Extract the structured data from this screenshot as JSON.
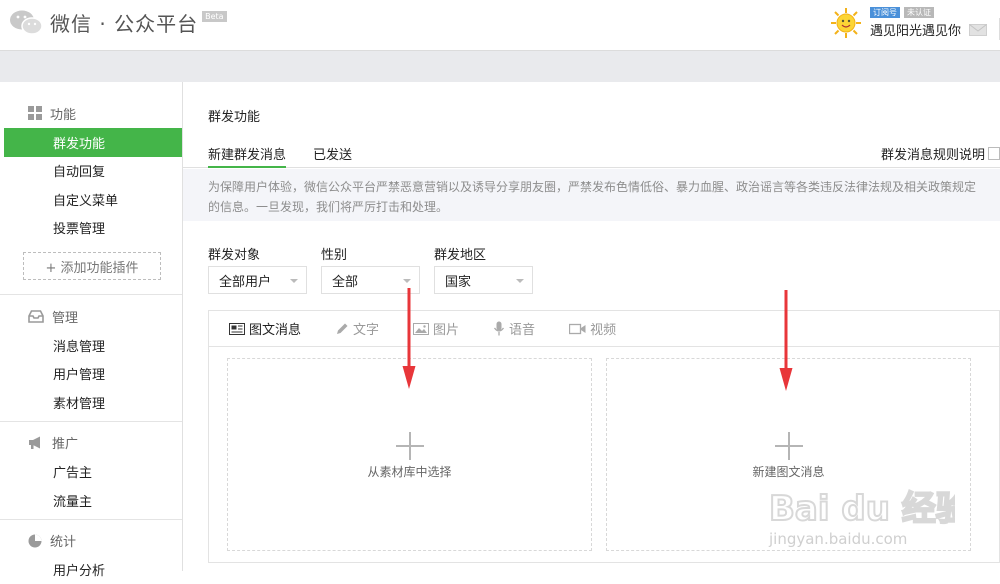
{
  "header": {
    "title": "微信 · 公众平台",
    "beta": "Beta",
    "tag_subscription": "订阅号",
    "tag_unverified": "未认证",
    "username": "遇见阳光遇见你"
  },
  "sidebar": {
    "groups": [
      {
        "title": "功能",
        "icon": "grid-icon",
        "items": [
          "群发功能",
          "自动回复",
          "自定义菜单",
          "投票管理"
        ]
      },
      {
        "title": "管理",
        "icon": "inbox-icon",
        "items": [
          "消息管理",
          "用户管理",
          "素材管理"
        ]
      },
      {
        "title": "推广",
        "icon": "megaphone-icon",
        "items": [
          "广告主",
          "流量主"
        ]
      },
      {
        "title": "统计",
        "icon": "pie-icon",
        "items": [
          "用户分析"
        ]
      }
    ],
    "add_plugin": "+ 添加功能插件",
    "active_item": "群发功能"
  },
  "main": {
    "page_title": "群发功能",
    "tabs": [
      "新建群发消息",
      "已发送"
    ],
    "rule_link": "群发消息规则说明",
    "notice_line1": "为保障用户体验，微信公众平台严禁恶意营销以及诱导分享朋友圈，严禁发布色情低俗、暴力血腥、政治谣言等各类违反法律法规及相关政策规定",
    "notice_line2": "的信息。一旦发现，我们将严厉打击和处理。",
    "filters": [
      {
        "label": "群发对象",
        "value": "全部用户"
      },
      {
        "label": "性别",
        "value": "全部"
      },
      {
        "label": "群发地区",
        "value": "国家"
      }
    ],
    "editor_tabs": [
      "图文消息",
      "文字",
      "图片",
      "语音",
      "视频"
    ],
    "card_left": "从素材库中选择",
    "card_right": "新建图文消息"
  },
  "colors": {
    "accent": "#44b549",
    "annotation_arrow": "#e8363a"
  },
  "watermark": {
    "brand": "Bai du 经验",
    "url": "jingyan.baidu.com"
  }
}
